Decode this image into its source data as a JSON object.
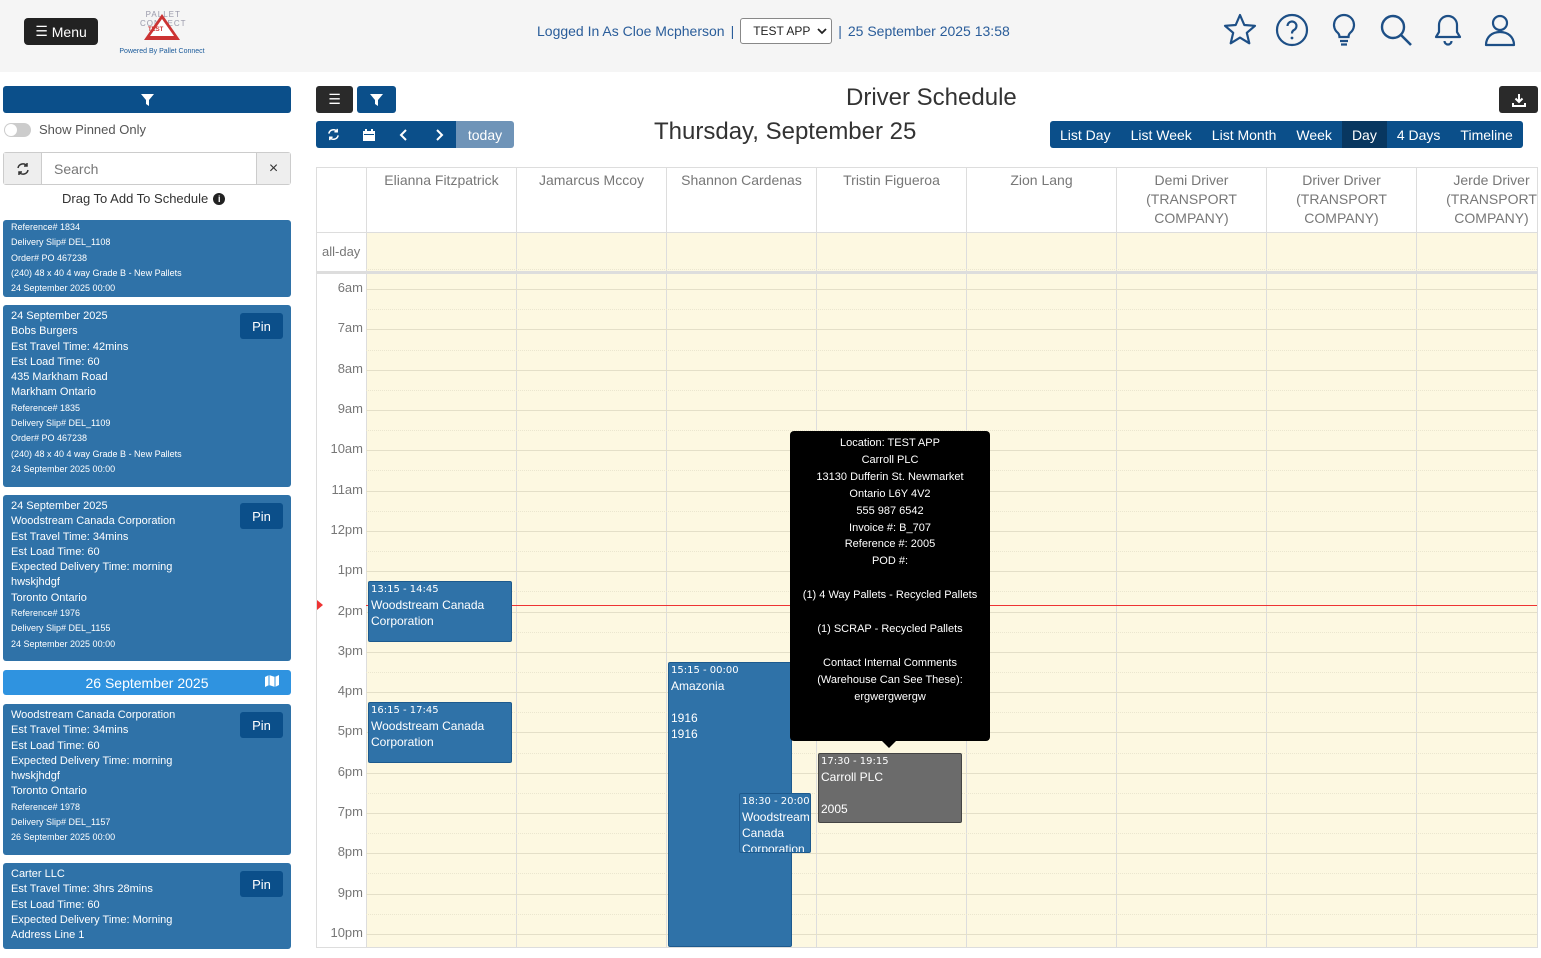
{
  "header": {
    "menu_label": "Menu",
    "logo_brand_top": "PALLET",
    "logo_brand_bottom": "CONNECT",
    "logo_tag": "TEST",
    "powered_by": "Powered By Pallet Connect",
    "logged_in": "Logged In As Cloe Mcpherson",
    "sep1": "|",
    "app_selected": "TEST APP",
    "sep2": "|",
    "datetime": "25 September 2025 13:58",
    "icons": [
      "star-icon",
      "help-icon",
      "lightbulb-icon",
      "search-icon",
      "bell-icon",
      "user-icon"
    ]
  },
  "sidebar": {
    "pinned_label": "Show Pinned Only",
    "search_placeholder": "Search",
    "drag_label": "Drag To Add To Schedule",
    "pin_label": "Pin",
    "date_header": "26 September 2025",
    "cards": [
      {
        "lines": [
          "Reference# 1834",
          "Delivery Slip# DEL_1108",
          "Order# PO 467238",
          "(240) 48 x 40 4 way Grade B - New Pallets",
          "24 September 2025 00:00"
        ],
        "small": [
          true,
          true,
          true,
          true,
          true
        ],
        "pin": false
      },
      {
        "lines": [
          "24 September 2025",
          "Bobs Burgers",
          "Est Travel Time: 42mins",
          "Est Load Time: 60",
          "435 Markham Road",
          "Markham Ontario",
          "Reference# 1835",
          "Delivery Slip# DEL_1109",
          "Order# PO 467238",
          "(240) 48 x 40 4 way Grade B - New Pallets",
          "24 September 2025 00:00"
        ],
        "small": [
          false,
          false,
          false,
          false,
          false,
          false,
          true,
          true,
          true,
          true,
          true
        ],
        "pin": true
      },
      {
        "lines": [
          "24 September 2025",
          "Woodstream Canada Corporation",
          "Est Travel Time: 34mins",
          "Est Load Time: 60",
          "Expected Delivery Time: morning",
          "hwskjhdgf",
          "Toronto Ontario",
          "Reference# 1976",
          "Delivery Slip# DEL_1155",
          "24 September 2025 00:00"
        ],
        "small": [
          false,
          false,
          false,
          false,
          false,
          false,
          false,
          true,
          true,
          true
        ],
        "pin": true
      },
      {
        "lines": [
          "Woodstream Canada Corporation",
          "Est Travel Time: 34mins",
          "Est Load Time: 60",
          "Expected Delivery Time: morning",
          "hwskjhdgf",
          "Toronto Ontario",
          "Reference# 1978",
          "Delivery Slip# DEL_1157",
          "26 September 2025 00:00"
        ],
        "small": [
          false,
          false,
          false,
          false,
          false,
          false,
          true,
          true,
          true
        ],
        "pin": true
      },
      {
        "lines": [
          "Carter LLC",
          "Est Travel Time: 3hrs 28mins",
          "Est Load Time: 60",
          "Expected Delivery Time: Morning",
          "Address Line 1"
        ],
        "small": [
          false,
          false,
          false,
          false,
          false
        ],
        "pin": true
      }
    ]
  },
  "toolbar": {
    "today_label": "today",
    "title": "Driver Schedule",
    "date_title": "Thursday, September 25",
    "views": [
      "List Day",
      "List Week",
      "List Month",
      "Week",
      "Day",
      "4 Days",
      "Timeline"
    ],
    "active_view": "Day"
  },
  "calendar": {
    "resources": [
      "Elianna Fitzpatrick",
      "Jamarcus Mccoy",
      "Shannon Cardenas",
      "Tristin Figueroa",
      "Zion Lang",
      "Demi Driver (TRANSPORT COMPANY)",
      "Driver Driver (TRANSPORT COMPANY)",
      "Jerde Driver (TRANSPORT COMPANY)"
    ],
    "allday_label": "all-day",
    "time_labels": [
      "6am",
      "7am",
      "8am",
      "9am",
      "10am",
      "11am",
      "12pm",
      "1pm",
      "2pm",
      "3pm",
      "4pm",
      "5pm",
      "6pm",
      "7pm",
      "8pm",
      "9pm",
      "10pm"
    ],
    "events": [
      {
        "time": "13:15 - 14:45",
        "title": "Woodstream Canada Corporation",
        "extra": [],
        "resource": 0,
        "start": 13.25,
        "end": 14.75,
        "grey": false
      },
      {
        "time": "16:15 - 17:45",
        "title": "Woodstream Canada Corporation",
        "extra": [],
        "resource": 0,
        "start": 16.25,
        "end": 17.75,
        "grey": false
      },
      {
        "time": "15:15 - 00:00",
        "title": "Amazonia",
        "extra": [
          "",
          "1916",
          "1916"
        ],
        "resource": 2,
        "start": 15.25,
        "end": 24,
        "grey": false
      },
      {
        "time": "18:30 - 20:00",
        "title": "Woodstream Canada Corporation",
        "extra": [],
        "resource": 2,
        "start": 18.5,
        "end": 20,
        "grey": false,
        "offset": true
      },
      {
        "time": "17:30 - 19:15",
        "title": "Carroll PLC",
        "extra": [
          "",
          "2005"
        ],
        "resource": 3,
        "start": 17.5,
        "end": 19.25,
        "grey": true
      }
    ]
  },
  "tooltip": {
    "lines": [
      "Location: TEST APP",
      "Carroll PLC",
      "13130 Dufferin St. Newmarket",
      "Ontario L6Y 4V2",
      "555 987 6542",
      "Invoice #: B_707",
      "Reference #: 2005",
      "POD #:",
      "",
      "(1) 4 Way Pallets - Recycled Pallets",
      "",
      "(1) SCRAP - Recycled Pallets",
      "",
      "Contact Internal Comments",
      "(Warehouse Can See These):",
      "ergwergwergw"
    ]
  }
}
